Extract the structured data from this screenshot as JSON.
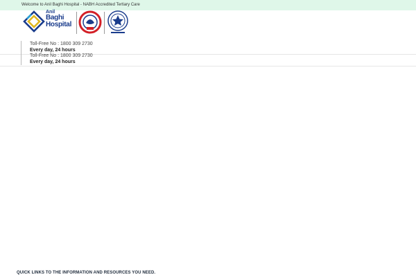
{
  "topbar": {
    "welcome": "Welcome to Anil Baghi Hospital - NABH Accredited Tertiary Care"
  },
  "logo": {
    "line1": "Anil",
    "line2": "Baghi",
    "line3": "Hospital"
  },
  "contacts": [
    {
      "toll_free": "Toll-Free No : 1800 309 2730",
      "hours": "Every day, 24 hours"
    },
    {
      "toll_free": "Toll-Free No : 1800 309 2730",
      "hours": "Every day, 24 hours"
    }
  ],
  "footer": {
    "quick_links": "QUICK LINKS TO THE INFORMATION AND RESOURCES YOU NEED."
  },
  "colors": {
    "topbar_bg": "#dff7e9",
    "brand_blue": "#1a3c8c",
    "brand_gold": "#e0b81f",
    "nabh_red": "#d32027"
  }
}
